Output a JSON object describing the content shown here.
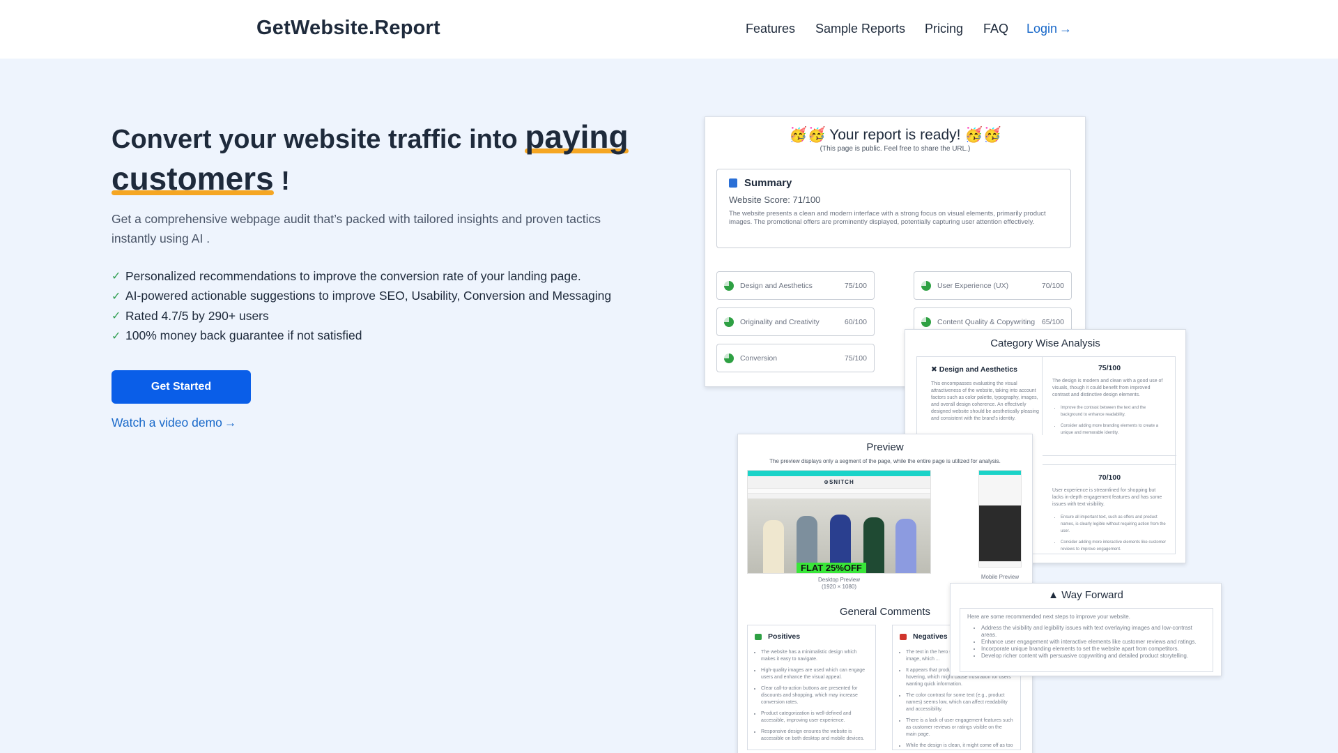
{
  "header": {
    "brand": "GetWebsite.Report",
    "nav": [
      "Features",
      "Sample Reports",
      "Pricing",
      "FAQ"
    ],
    "login": "Login",
    "arrow": "→"
  },
  "hero": {
    "title_pre": "Convert your website traffic into",
    "title_hl1": "paying",
    "title_hl2": "customers",
    "title_post": "!",
    "subtitle": "Get a comprehensive webpage audit that’s packed with tailored insights and proven tactics instantly using AI .",
    "bullets": [
      "Personalized recommendations to improve the conversion rate of your landing page.",
      "AI-powered actionable suggestions to improve SEO, Usability, Conversion and Messaging",
      "Rated 4.7/5 by 290+ users",
      "100% money back guarantee if not satisfied"
    ],
    "cta": "Get Started",
    "video_link": "Watch a video demo"
  },
  "report": {
    "title": "🥳🥳 Your report is ready! 🥳🥳",
    "note": "(This page is public. Feel free to share the URL.)",
    "summary_heading": "Summary",
    "score": "Website Score: 71/100",
    "summary_text": "The website presents a clean and modern interface with a strong focus on visual elements, primarily product images. The promotional offers are prominently displayed, potentially capturing user attention effectively.",
    "metrics": [
      {
        "label": "Design and Aesthetics",
        "value": "75/100"
      },
      {
        "label": "User Experience (UX)",
        "value": "70/100"
      },
      {
        "label": "Originality and Creativity",
        "value": "60/100"
      },
      {
        "label": "Content Quality & Copywriting",
        "value": "65/100"
      },
      {
        "label": "Conversion",
        "value": "75/100"
      }
    ]
  },
  "category": {
    "title": "Category Wise Analysis",
    "left_heading": "Design and Aesthetics",
    "left_text": "This encompasses evaluating the visual attractiveness of the website, taking into account factors such as color palette, typography, images, and overall design coherence. An effectively designed website should be aesthetically pleasing and consistent with the brand's identity.",
    "r1_score": "75/100",
    "r1_text": "The design is modern and clean with a good use of visuals, though it could benefit from improved contrast and distinctive design elements.",
    "r1_bullets": [
      "Improve the contrast between the text and the background to enhance readability.",
      "Consider adding more branding elements to create a unique and memorable identity."
    ],
    "r2_score": "70/100",
    "r2_text": "User experience is streamlined for shopping but lacks in-depth engagement features and has some issues with text visibility.",
    "r2_bullets": [
      "Ensure all important text, such as offers and product names, is clearly legible without requiring action from the user.",
      "Consider adding more interactive elements like customer reviews to improve engagement."
    ]
  },
  "preview": {
    "title": "Preview",
    "note": "The preview displays only a segment of the page, while the entire page is utilized for analysis.",
    "site_logo": "⊛SNITCH",
    "banner": "FLAT 25%OFF",
    "desktop_caption": "Desktop Preview",
    "desktop_size": "(1920 × 1080)",
    "mobile_caption": "Mobile Preview",
    "gc_title": "General Comments",
    "positives_heading": "Positives",
    "positives": [
      "The website has a minimalistic design which makes it easy to navigate.",
      "High-quality images are used which can engage users and enhance the visual appeal.",
      "Clear call-to-action buttons are presented for discounts and shopping, which may increase conversion rates.",
      "Product categorization is well-defined and accessible, improving user experience.",
      "Responsive design ensures the website is accessible on both desktop and mobile devices."
    ],
    "negatives_heading": "Negatives",
    "negatives": [
      "The text in the hero section overlaps the product image, which ...",
      "It appears that product names appear only on hovering, which might cause frustration for users wanting quick information.",
      "The color contrast for some text (e.g., product names) seems low, which can affect readability and accessibility.",
      "There is a lack of user engagement features such as customer reviews or ratings visible on the main page.",
      "While the design is clean, it might come off as too simplistic, lacking unique design elements that set the brand apart."
    ]
  },
  "wayforward": {
    "title": "Way Forward",
    "intro": "Here are some recommended next steps to improve your website.",
    "items": [
      "Address the visibility and legibility issues with text overlaying images and low-contrast areas.",
      "Enhance user engagement with interactive elements like customer reviews and ratings.",
      "Incorporate unique branding elements to set the website apart from competitors.",
      "Develop richer content with persuasive copywriting and detailed product storytelling."
    ]
  },
  "colors": {
    "accent": "#0a5ee8",
    "link": "#1868c9",
    "highlight": "#f5a623",
    "check": "#2e9e4f",
    "background": "#eef4fd"
  }
}
